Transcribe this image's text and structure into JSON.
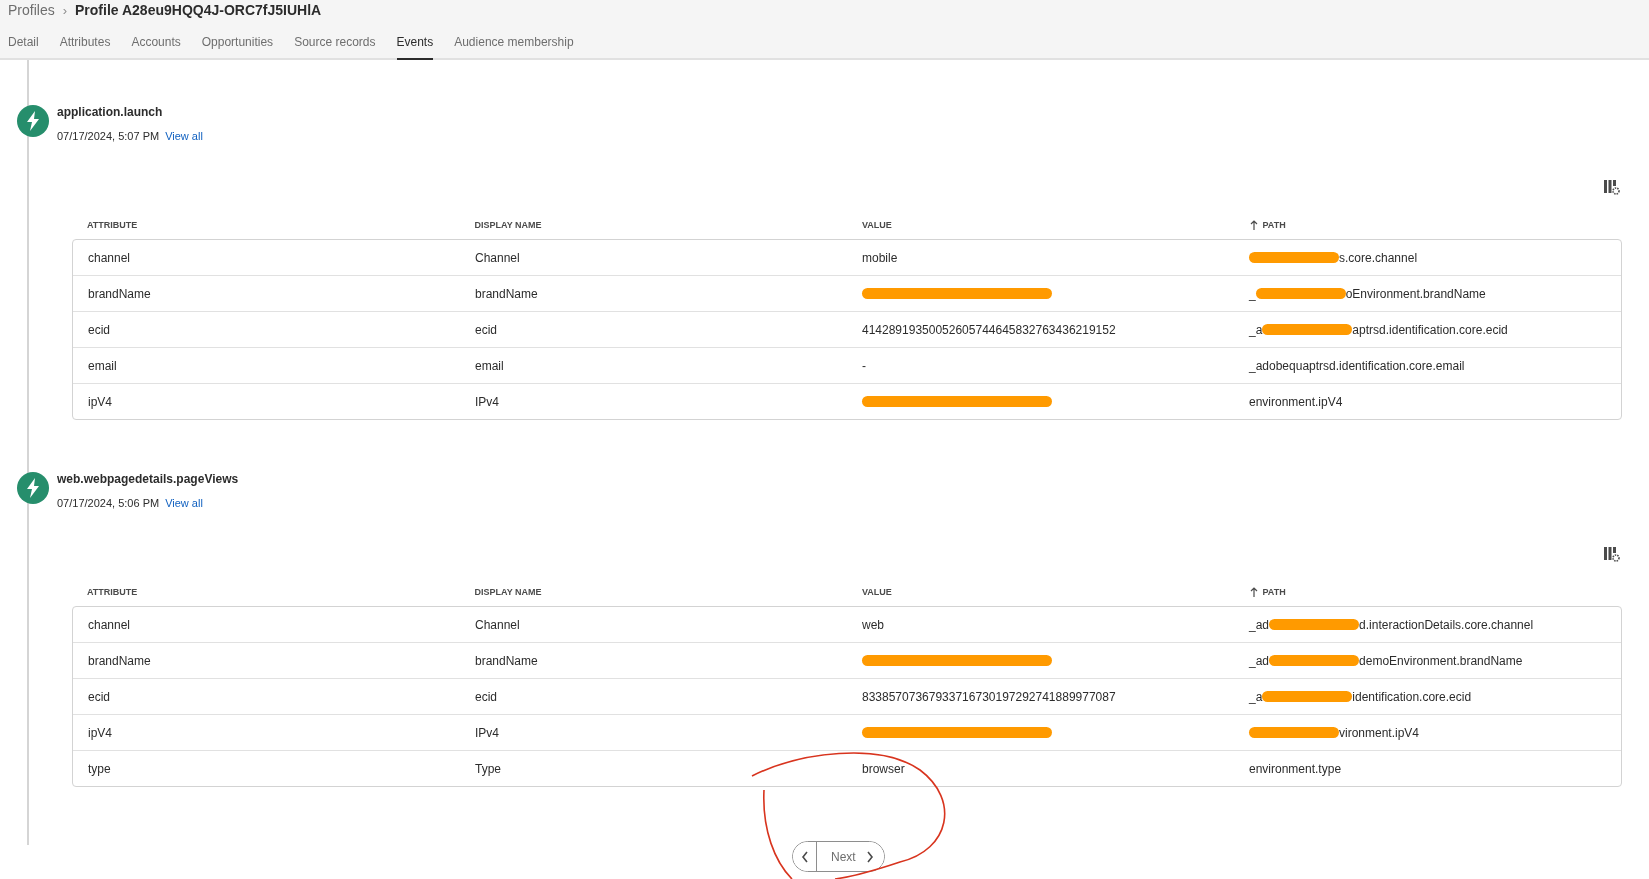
{
  "breadcrumb": {
    "parent": "Profiles",
    "separator": "›",
    "current": "Profile A28eu9HQQ4J-ORC7fJ5IUHlA"
  },
  "tabs": [
    {
      "label": "Detail",
      "selected": false
    },
    {
      "label": "Attributes",
      "selected": false
    },
    {
      "label": "Accounts",
      "selected": false
    },
    {
      "label": "Opportunities",
      "selected": false
    },
    {
      "label": "Source records",
      "selected": false
    },
    {
      "label": "Events",
      "selected": true
    },
    {
      "label": "Audience membership",
      "selected": false
    }
  ],
  "events": [
    {
      "title": "application.launch",
      "timestamp": "07/17/2024, 5:07 PM",
      "link": "View all",
      "columns": [
        {
          "label": "ATTRIBUTE",
          "sorted": false
        },
        {
          "label": "DISPLAY NAME",
          "sorted": false
        },
        {
          "label": "VALUE",
          "sorted": false
        },
        {
          "label": "PATH",
          "sorted": true
        }
      ],
      "rows": [
        [
          {
            "text": "channel"
          },
          {
            "text": "Channel"
          },
          {
            "text": "mobile"
          },
          {
            "redacted": true,
            "text": "s.core.channel"
          }
        ],
        [
          {
            "text": "brandName"
          },
          {
            "text": "brandName"
          },
          {
            "redacted": true
          },
          {
            "before": "_",
            "redacted": true,
            "text": "oEnvironment.brandName"
          }
        ],
        [
          {
            "text": "ecid"
          },
          {
            "text": "ecid"
          },
          {
            "text": "41428919350052605744645832763436219152"
          },
          {
            "before": "_a",
            "redacted": true,
            "text": "aptrsd.identification.core.ecid"
          }
        ],
        [
          {
            "text": "email"
          },
          {
            "text": "email"
          },
          {
            "text": "-"
          },
          {
            "text": "_adobequaptrsd.identification.core.email"
          }
        ],
        [
          {
            "text": "ipV4"
          },
          {
            "text": "IPv4"
          },
          {
            "redacted": true
          },
          {
            "text": "environment.ipV4"
          }
        ]
      ]
    },
    {
      "title": "web.webpagedetails.pageViews",
      "timestamp": "07/17/2024, 5:06 PM",
      "link": "View all",
      "columns": [
        {
          "label": "ATTRIBUTE",
          "sorted": false
        },
        {
          "label": "DISPLAY NAME",
          "sorted": false
        },
        {
          "label": "VALUE",
          "sorted": false
        },
        {
          "label": "PATH",
          "sorted": true
        }
      ],
      "rows": [
        [
          {
            "text": "channel"
          },
          {
            "text": "Channel"
          },
          {
            "text": "web"
          },
          {
            "before": "_ad",
            "redacted": true,
            "text": "d.interactionDetails.core.channel"
          }
        ],
        [
          {
            "text": "brandName"
          },
          {
            "text": "brandName"
          },
          {
            "redacted": true
          },
          {
            "before": "_ad",
            "redacted": true,
            "text": "demoEnvironment.brandName"
          }
        ],
        [
          {
            "text": "ecid"
          },
          {
            "text": "ecid"
          },
          {
            "text": "83385707367933716730197292741889977087"
          },
          {
            "before": "_a",
            "redacted": true,
            "text": "identification.core.ecid"
          }
        ],
        [
          {
            "text": "ipV4"
          },
          {
            "text": "IPv4"
          },
          {
            "redacted": true
          },
          {
            "redacted": true,
            "text": "vironment.ipV4"
          }
        ],
        [
          {
            "text": "type"
          },
          {
            "text": "Type"
          },
          {
            "text": "browser"
          },
          {
            "text": "environment.type"
          }
        ]
      ]
    }
  ],
  "pagination": {
    "next": "Next"
  }
}
